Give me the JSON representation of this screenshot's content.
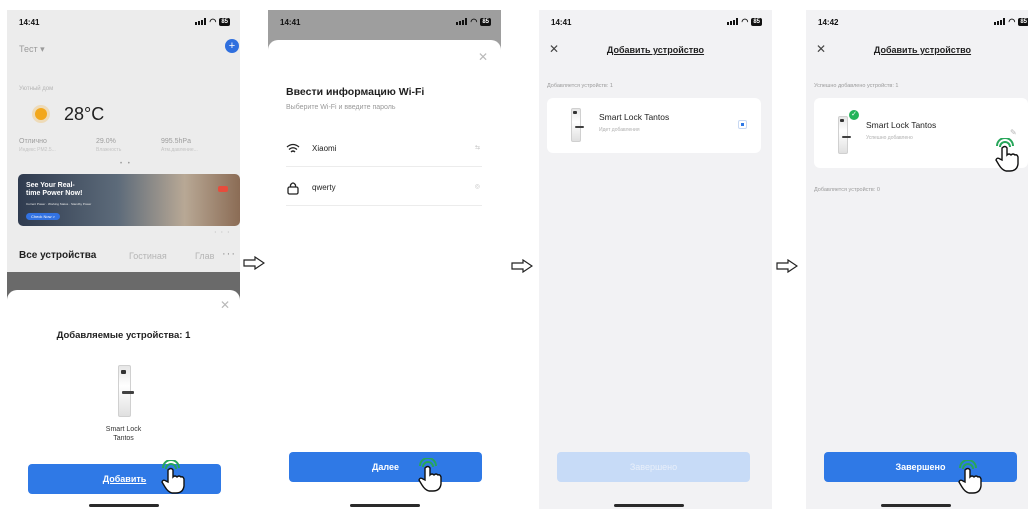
{
  "screen1": {
    "status": {
      "time": "14:41",
      "battery": "85"
    },
    "home_title": "Тест ▾",
    "weather": {
      "city": "Уютный дом",
      "temperature": "28°C",
      "metrics": [
        {
          "value": "Отлично",
          "label": "Индекс PM2.5..."
        },
        {
          "value": "29.0%",
          "label": "Влажность"
        },
        {
          "value": "995.5hPa",
          "label": "Атм.давление..."
        }
      ]
    },
    "banner": {
      "title": "See Your Real-time Power Now!",
      "small": "Current Power · Working Status · Standby Power",
      "button": "Check Now >"
    },
    "tabs": [
      "Все устройства",
      "Гостиная",
      "Глав"
    ],
    "sheet": {
      "title": "Добавляемые устройства: 1",
      "device_name": "Smart Lock Tantos",
      "button": "Добавить"
    }
  },
  "screen2": {
    "status": {
      "time": "14:41",
      "battery": "85"
    },
    "title": "Ввести информацию Wi-Fi",
    "subtitle": "Выберите Wi-Fi и введите пароль",
    "ssid": "Xiaomi",
    "password": "qwerty",
    "button": "Далее"
  },
  "screen3": {
    "status": {
      "time": "14:41",
      "battery": "85"
    },
    "nav_title": "Добавить устройство",
    "section": "Добавляется устройств: 1",
    "device_name": "Smart Lock Tantos",
    "device_status": "Идет добавления",
    "button": "Завершено"
  },
  "screen4": {
    "status": {
      "time": "14:42",
      "battery": "85"
    },
    "nav_title": "Добавить устройство",
    "section_done": "Успешно добавлено устройств: 1",
    "device_name": "Smart Lock Tantos",
    "device_status": "Успешно добавлено",
    "section_pending": "Добавляется устройств: 0",
    "button": "Завершено"
  },
  "colors": {
    "accent": "#2f79e6",
    "success": "#24b35a",
    "tap_indicator": "#27a65a"
  },
  "icons": [
    "search-icon",
    "wifi-icon",
    "lock-icon",
    "eye-icon",
    "close-icon",
    "arrow-right-icon",
    "hand-pointer-icon",
    "check-icon",
    "edit-icon"
  ]
}
